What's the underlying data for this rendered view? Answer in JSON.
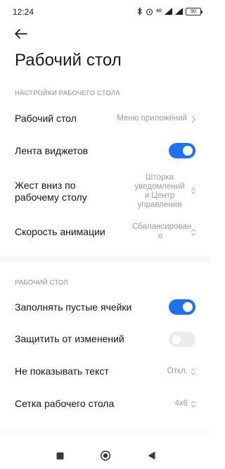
{
  "status": {
    "time": "12:24",
    "network": "4G",
    "battery": "90",
    "icons": [
      "bluetooth-icon",
      "alarm-icon",
      "network-4g-icon",
      "signal-icon",
      "signal-icon",
      "battery-icon"
    ]
  },
  "header": {
    "back_icon": "back-arrow-icon",
    "title": "Рабочий стол"
  },
  "sections": [
    {
      "title": "НАСТРОЙКИ РАБОЧЕГО СТОЛА",
      "rows": [
        {
          "label": "Рабочий стол",
          "value": "Меню приложений",
          "control": "chevron-right"
        },
        {
          "label": "Лента виджетов",
          "control": "toggle",
          "state": true
        },
        {
          "label_line1": "Жест вниз по",
          "label_line2": "рабочему столу",
          "value_line1": "Шторка",
          "value_line2": "уведомлений",
          "value_line3": "и Центр",
          "value_line4": "управления",
          "control": "chevron-updown"
        },
        {
          "label": "Скорость анимации",
          "value_line1": "Сбалансирован",
          "value_line2": "о",
          "control": "chevron-updown"
        }
      ]
    },
    {
      "title": "РАБОЧИЙ СТОЛ",
      "rows": [
        {
          "label": "Заполнять пустые ячейки",
          "control": "toggle",
          "state": true
        },
        {
          "label": "Защитить от изменений",
          "control": "toggle",
          "state": false
        },
        {
          "label": "Не показывать текст",
          "value": "Откл.",
          "control": "chevron-updown"
        },
        {
          "label": "Сетка рабочего стола",
          "value": "4х6",
          "control": "chevron-updown"
        }
      ]
    }
  ],
  "colors": {
    "accent": "#1d72f2",
    "toggle_off": "#ececec",
    "secondary_text": "#9a9a9a",
    "section_header": "#8a8a8a"
  },
  "nav": {
    "recents_icon": "square-icon",
    "home_icon": "circle-icon",
    "back_icon": "triangle-back-icon"
  }
}
